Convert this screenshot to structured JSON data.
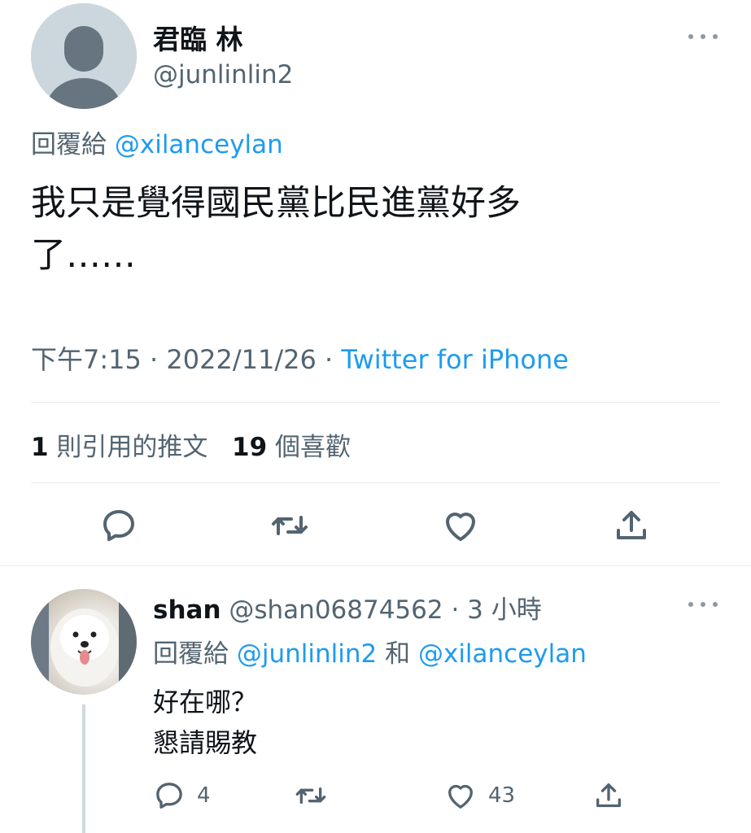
{
  "tweet": {
    "author_name": "君臨 林",
    "author_handle": "@junlinlin2",
    "replying_prefix": "回覆給 ",
    "replying_to": "@xilanceylan",
    "text_line1": "我只是覺得國民黨比民進黨好多",
    "text_line2": "了……",
    "time": "下午7:15",
    "sep1": " · ",
    "date": "2022/11/26",
    "sep2": " · ",
    "source": "Twitter for iPhone",
    "quote_count": "1",
    "quote_label": " 則引用的推文",
    "like_count": "19",
    "like_label": " 個喜歡"
  },
  "reply": {
    "author_name": "shan",
    "author_handle": "@shan06874562",
    "time_sep": " · ",
    "time": "3 小時",
    "replying_prefix": "回覆給 ",
    "replying_to_1": "@junlinlin2",
    "replying_and": " 和 ",
    "replying_to_2": "@xilanceylan",
    "text_line1": "好在哪？",
    "text_line2": "懇請賜教",
    "reply_count": "4",
    "like_count": "43"
  },
  "colors": {
    "link": "#1d9bf0",
    "muted": "#536471",
    "text": "#0f1419",
    "divider": "#e6ecf0"
  },
  "icons": [
    "more-icon",
    "reply-icon",
    "retweet-icon",
    "like-icon",
    "share-icon"
  ]
}
